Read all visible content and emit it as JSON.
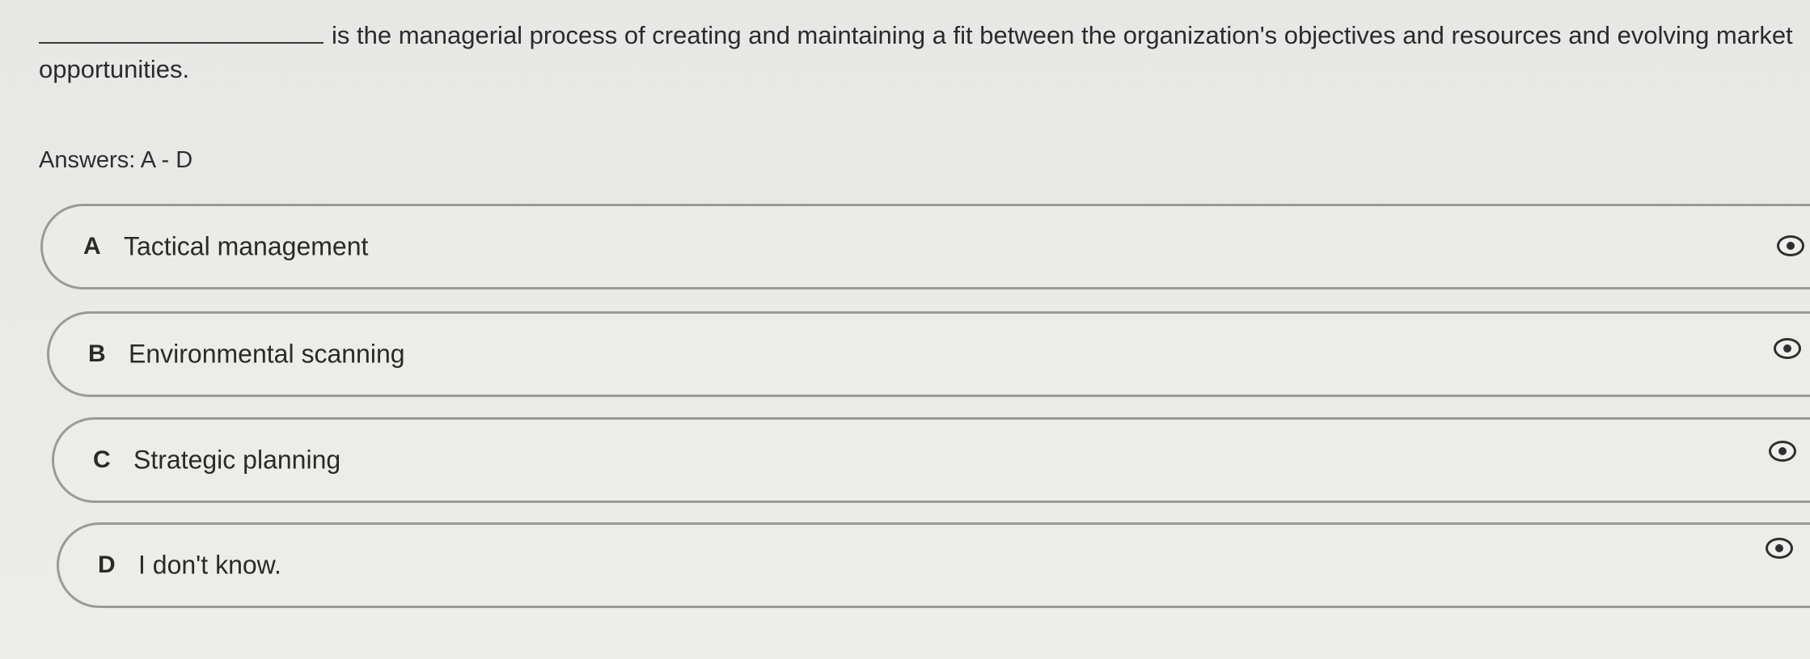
{
  "question": {
    "text": "is the managerial process of creating and maintaining a fit between the organization's objectives and resources and evolving market opportunities."
  },
  "answers_label": "Answers: A - D",
  "options": [
    {
      "letter": "A",
      "label": "Tactical management",
      "icon": "eye-icon"
    },
    {
      "letter": "B",
      "label": "Environmental scanning",
      "icon": "eye-icon"
    },
    {
      "letter": "C",
      "label": "Strategic planning",
      "icon": "eye-icon"
    },
    {
      "letter": "D",
      "label": "I don't know.",
      "icon": "eye-icon"
    }
  ]
}
